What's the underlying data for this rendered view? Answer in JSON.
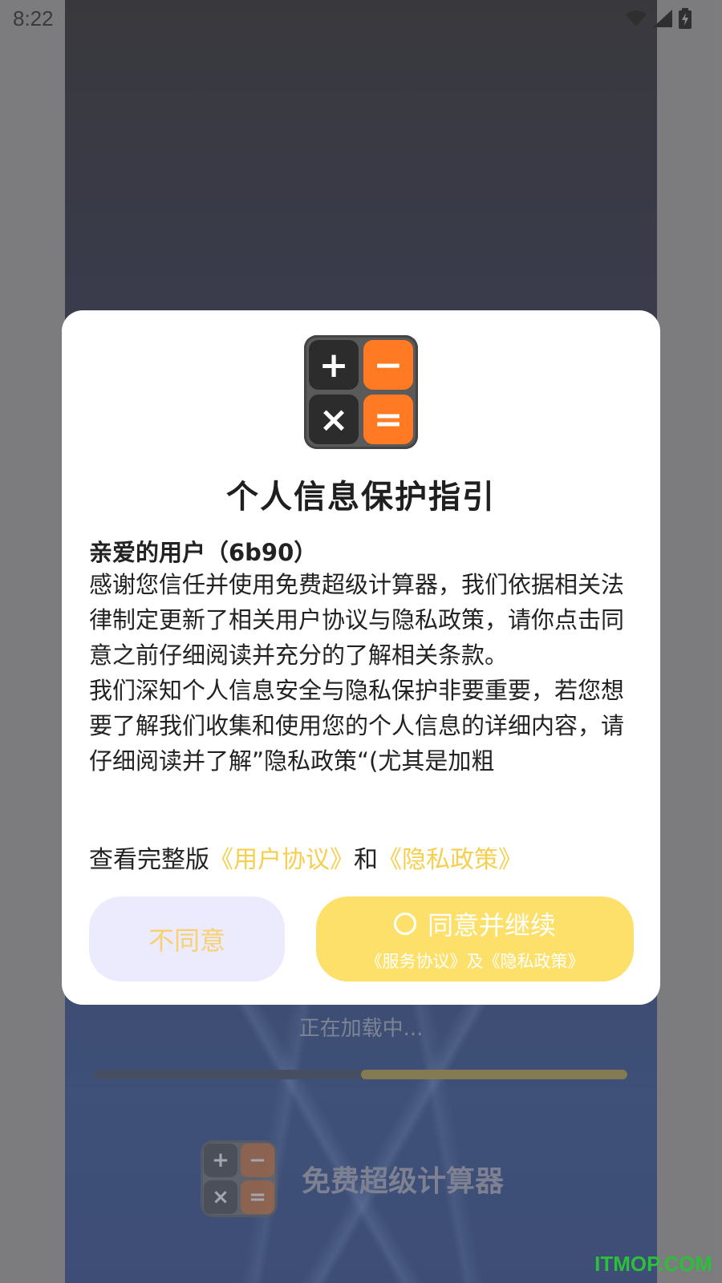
{
  "status_bar": {
    "time": "8:22",
    "icons": [
      "wifi-icon",
      "signal-icon",
      "battery-charging-icon"
    ]
  },
  "dialog": {
    "logo_keys": [
      "+",
      "−",
      "×",
      "="
    ],
    "title": "个人信息保护指引",
    "greeting": "亲爱的用户（6b90）",
    "paragraph1": "感谢您信任并使用免费超级计算器，我们依据相关法律制定更新了相关用户协议与隐私政策，请你点击同意之前仔细阅读并充分的了解相关条款。",
    "paragraph2": "我们深知个人信息安全与隐私保护非要重要，若您想要了解我们收集和使用您的个人信息的详细内容，请仔细阅读并了解”隐私政策“(尤其是加粗",
    "links_prefix": "查看完整版",
    "user_agreement_link": "《用户协议》",
    "links_and": "和",
    "privacy_policy_link": "《隐私政策》",
    "decline_label": "不同意",
    "agree_label": "同意并继续",
    "agree_sublabel": "《服务协议》及《隐私政策》",
    "colors": {
      "accent_yellow": "#fde06a",
      "link_yellow": "#f6cf4e",
      "decline_bg": "#ecebfd",
      "logo_orange": "#ff7a22"
    }
  },
  "background": {
    "loading_text": "正在加载中...",
    "loading_progress": 0.5,
    "app_name": "免费超级计算器",
    "watermark": "ITMOP.COM"
  }
}
